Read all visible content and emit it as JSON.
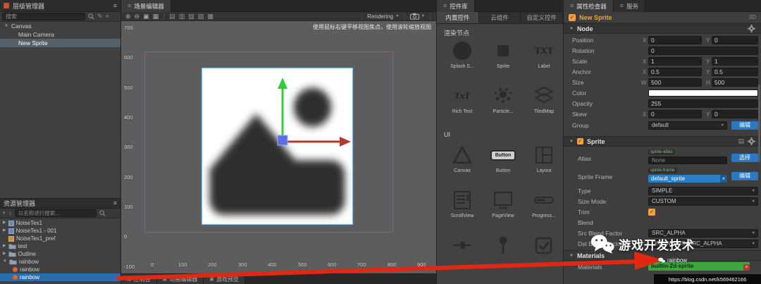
{
  "colors": {
    "accent_orange": "#f6a23c",
    "accent_blue": "#2a78c2",
    "selection_blue": "#2a6dad",
    "highlight_green": "#3fa53f",
    "design_border_magenta": "#d02bd0",
    "arrow_red": "#e02814",
    "gizmo_green": "#2ecc40",
    "gizmo_red": "#b03a2e",
    "gizmo_blue": "#5b6ee1"
  },
  "icons": {
    "menu": "≡",
    "caret_down": "▼",
    "caret_right": "▶",
    "plus": "+",
    "pencil": "✎",
    "sort": "↕",
    "check": "✓",
    "close": "×",
    "dropdown": "▼",
    "zoom_in": "⊕",
    "zoom_out": "⊖",
    "frame": "▣",
    "grid": "▦",
    "align_a": "▤",
    "align_b": "▥",
    "align_c": "▧",
    "align_d": "▨",
    "align_e": "▩",
    "sep": "│"
  },
  "hierarchy": {
    "title": "层级管理器",
    "search_placeholder": "搜索",
    "items": [
      {
        "label": "Canvas"
      },
      {
        "label": "Main Camera"
      },
      {
        "label": "New Sprite"
      }
    ]
  },
  "assets": {
    "title": "资源管理器",
    "search_placeholder": "以名称进行搜索...",
    "items": [
      {
        "label": "NoiseTex1"
      },
      {
        "label": "NoiseTex1 - 001"
      },
      {
        "label": "NoiseTex1_pref"
      },
      {
        "label": "test"
      },
      {
        "label": "Outline"
      },
      {
        "label": "rainbow"
      },
      {
        "label": "rainbow"
      },
      {
        "label": "rainbow"
      }
    ]
  },
  "scene": {
    "tab": "场景编辑器",
    "hint": "使用鼠标右键平移视图焦点，使用滚轮缩放视图",
    "rendering": "Rendering",
    "v_ruler": [
      "700",
      "600",
      "500",
      "400",
      "300",
      "200",
      "100",
      "0",
      "-100"
    ],
    "h_ruler": [
      "0",
      "100",
      "200",
      "300",
      "400",
      "500",
      "600",
      "700",
      "800",
      "900"
    ]
  },
  "bottom_tabs": {
    "console": "控制台",
    "animation": "动画编辑器",
    "preview": "游戏预览"
  },
  "library": {
    "title": "控件库",
    "tabs": {
      "builtin": "内置控件",
      "cloud": "云组件",
      "custom": "自定义控件"
    },
    "sections": {
      "render": "渲染节点",
      "ui": "UI"
    },
    "items": {
      "splash": "Splash S...",
      "sprite": "Sprite",
      "label": "Label",
      "label_glyph": "TXT",
      "richtext": "Rich Text",
      "richtext_glyph": "TxT",
      "particle": "Particle...",
      "tiledmap": "TiledMap",
      "canvas": "Canvas",
      "button": "Button",
      "button_glyph": "Button",
      "layout": "Layout",
      "scrollview": "ScrollView",
      "pageview": "PageView",
      "progress": "Progress..."
    }
  },
  "inspector": {
    "tab": "属性检查器",
    "services_tab": "服务",
    "node_name": "New Sprite",
    "mode": "3D",
    "node": {
      "title": "Node",
      "labels": {
        "position": "Position",
        "rotation": "Rotation",
        "scale": "Scale",
        "anchor": "Anchor",
        "size": "Size",
        "color": "Color",
        "opacity": "Opacity",
        "skew": "Skew",
        "group": "Group"
      },
      "axis": {
        "x": "X",
        "y": "Y",
        "w": "W",
        "h": "H"
      },
      "values": {
        "position_x": "0",
        "position_y": "0",
        "rotation": "0",
        "scale_x": "1",
        "scale_y": "1",
        "anchor_x": "0.5",
        "anchor_y": "0.5",
        "size_w": "500",
        "size_h": "500",
        "opacity": "255",
        "skew_x": "0",
        "skew_y": "0",
        "group": "default"
      },
      "edit_button": "编辑"
    },
    "sprite": {
      "title": "Sprite",
      "labels": {
        "atlas": "Atlas",
        "sprite_frame": "Sprite Frame",
        "type": "Type",
        "size_mode": "Size Mode",
        "trim": "Trim",
        "blend": "Blend",
        "src_blend": "Src Blend Factor",
        "dst_blend": "Dst Blend Factor",
        "materials": "Materials"
      },
      "atlas_tag": "sprite-atlas",
      "atlas_value": "None",
      "select_button": "选择",
      "frame_tag": "sprite-frame",
      "frame_value": "default_sprite",
      "edit_button": "编辑",
      "type_value": "SIMPLE",
      "size_mode_value": "CUSTOM",
      "src_blend_value": "SRC_ALPHA",
      "dst_blend_value": "ONE_MINUS_SRC_ALPHA",
      "materials_title": "Materials",
      "materials_value": "builtin-2d-sprite"
    }
  },
  "watermark": {
    "text": "游戏开发技术",
    "handle": "rainbow",
    "url": "https://blog.csdn.net/k569462166"
  }
}
